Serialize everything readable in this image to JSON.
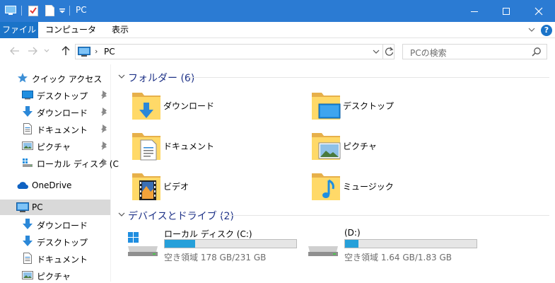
{
  "window": {
    "title": "PC",
    "controls": {
      "minimize": "minimize",
      "maximize": "maximize",
      "close": "close"
    }
  },
  "ribbon": {
    "tabs": [
      {
        "label": "ファイル"
      },
      {
        "label": "コンピューター"
      },
      {
        "label": "表示"
      }
    ],
    "help_label": "?"
  },
  "address": {
    "breadcrumb": "PC",
    "search_placeholder": "PCの検索"
  },
  "nav_pane": {
    "quick_access": "クイック アクセス",
    "pinned": [
      {
        "label": "デスクトップ",
        "icon": "desktop-icon"
      },
      {
        "label": "ダウンロード",
        "icon": "download-icon"
      },
      {
        "label": "ドキュメント",
        "icon": "document-icon"
      },
      {
        "label": "ピクチャ",
        "icon": "picture-icon"
      },
      {
        "label": "ローカル ディスク (C",
        "icon": "local-disk-icon"
      }
    ],
    "onedrive": "OneDrive",
    "pc": "PC",
    "pc_children": [
      {
        "label": "ダウンロード",
        "icon": "download-icon"
      },
      {
        "label": "デスクトップ",
        "icon": "desktop-icon"
      },
      {
        "label": "ドキュメント",
        "icon": "document-icon"
      },
      {
        "label": "ピクチャ",
        "icon": "picture-icon"
      }
    ]
  },
  "content": {
    "folders_header": "フォルダー (6)",
    "folders": [
      {
        "label": "ダウンロード",
        "overlay": "download"
      },
      {
        "label": "デスクトップ",
        "overlay": "desktop"
      },
      {
        "label": "ドキュメント",
        "overlay": "document"
      },
      {
        "label": "ピクチャ",
        "overlay": "picture"
      },
      {
        "label": "ビデオ",
        "overlay": "video"
      },
      {
        "label": "ミュージック",
        "overlay": "music"
      }
    ],
    "drives_header": "デバイスとドライブ (2)",
    "drives": [
      {
        "name": "ローカル ディスク (C:)",
        "free_text": "空き領域 178 GB/231 GB",
        "used_fraction": 0.23,
        "windows_logo": true
      },
      {
        "name": "(D:)",
        "free_text": "空き領域 1.64 GB/1.83 GB",
        "used_fraction": 0.1,
        "windows_logo": false
      }
    ]
  },
  "colors": {
    "titlebar": "#2b7bd3",
    "file_tab": "#1a73c8",
    "group_header": "#1e3287",
    "drive_bar": "#26a0da",
    "selection": "#d9d9d9"
  }
}
